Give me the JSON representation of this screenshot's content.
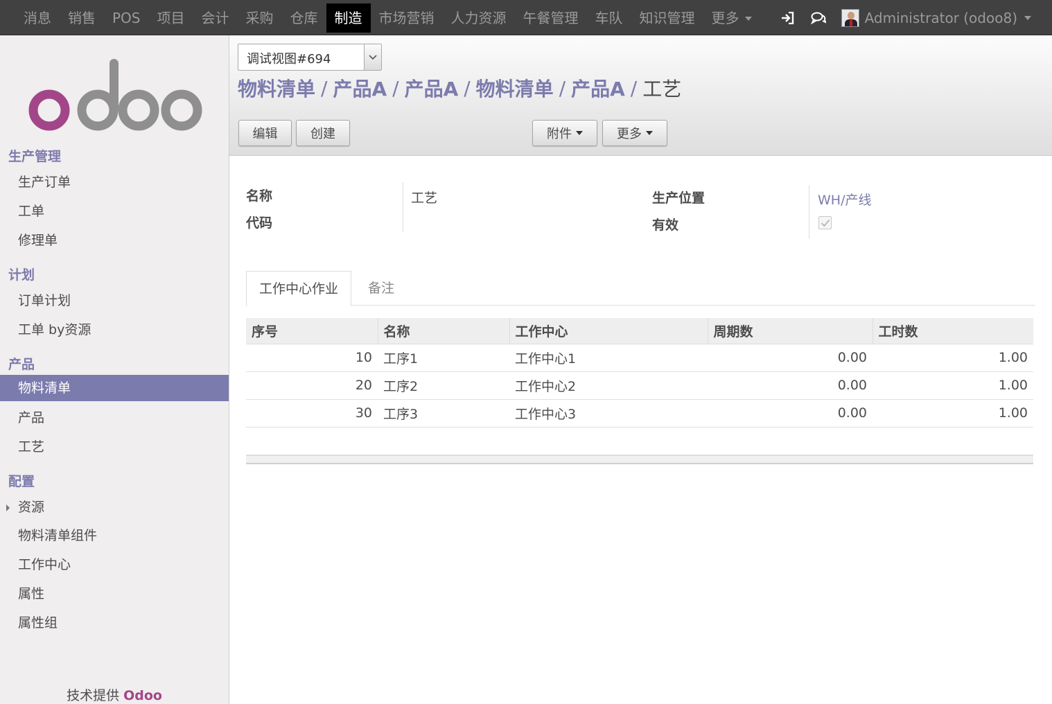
{
  "topbar": {
    "menu": [
      {
        "label": "消息",
        "active": false
      },
      {
        "label": "销售",
        "active": false
      },
      {
        "label": "POS",
        "active": false
      },
      {
        "label": "项目",
        "active": false
      },
      {
        "label": "会计",
        "active": false
      },
      {
        "label": "采购",
        "active": false
      },
      {
        "label": "仓库",
        "active": false
      },
      {
        "label": "制造",
        "active": true
      },
      {
        "label": "市场营销",
        "active": false
      },
      {
        "label": "人力资源",
        "active": false
      },
      {
        "label": "午餐管理",
        "active": false
      },
      {
        "label": "车队",
        "active": false
      },
      {
        "label": "知识管理",
        "active": false
      }
    ],
    "more_label": "更多",
    "user_name": "Administrator (odoo8)",
    "icons": [
      "sign-in-icon",
      "chat-icon"
    ]
  },
  "sidebar": {
    "sections": [
      {
        "title": "生产管理",
        "items": [
          {
            "label": "生产订单"
          },
          {
            "label": "工单"
          },
          {
            "label": "修理单"
          }
        ]
      },
      {
        "title": "计划",
        "items": [
          {
            "label": "订单计划"
          },
          {
            "label": "工单 by资源"
          }
        ]
      },
      {
        "title": "产品",
        "items": [
          {
            "label": "物料清单",
            "active": true
          },
          {
            "label": "产品"
          },
          {
            "label": "工艺"
          }
        ]
      },
      {
        "title": "配置",
        "items": [
          {
            "label": "资源",
            "expandable": true
          },
          {
            "label": "物料清单组件"
          },
          {
            "label": "工作中心"
          },
          {
            "label": "属性"
          },
          {
            "label": "属性组"
          }
        ]
      }
    ],
    "powered_by": "技术提供",
    "powered_brand": "Odoo"
  },
  "control_panel": {
    "view_selector": "调试视图#694",
    "breadcrumbs": [
      "物料清单",
      "产品A",
      "产品A",
      "物料清单",
      "产品A"
    ],
    "breadcrumb_current": "工艺",
    "edit_label": "编辑",
    "create_label": "创建",
    "attachment_label": "附件",
    "more_label": "更多"
  },
  "form": {
    "name_label": "名称",
    "name_value": "工艺",
    "code_label": "代码",
    "code_value": "",
    "location_label": "生产位置",
    "location_value": "WH/产线",
    "active_label": "有效",
    "active_value": true
  },
  "tabs": [
    {
      "label": "工作中心作业",
      "active": true
    },
    {
      "label": "备注",
      "active": false
    }
  ],
  "operations": {
    "columns": [
      "序号",
      "名称",
      "工作中心",
      "周期数",
      "工时数"
    ],
    "rows": [
      {
        "seq": "10",
        "name": "工序1",
        "workcenter": "工作中心1",
        "cycles": "0.00",
        "hours": "1.00"
      },
      {
        "seq": "20",
        "name": "工序2",
        "workcenter": "工作中心2",
        "cycles": "0.00",
        "hours": "1.00"
      },
      {
        "seq": "30",
        "name": "工序3",
        "workcenter": "工作中心3",
        "cycles": "0.00",
        "hours": "1.00"
      }
    ]
  },
  "colors": {
    "topbar": "#414141",
    "accent": "#7c7bad",
    "logo_purple": "#a24689",
    "logo_gray": "#8f8f8f"
  }
}
